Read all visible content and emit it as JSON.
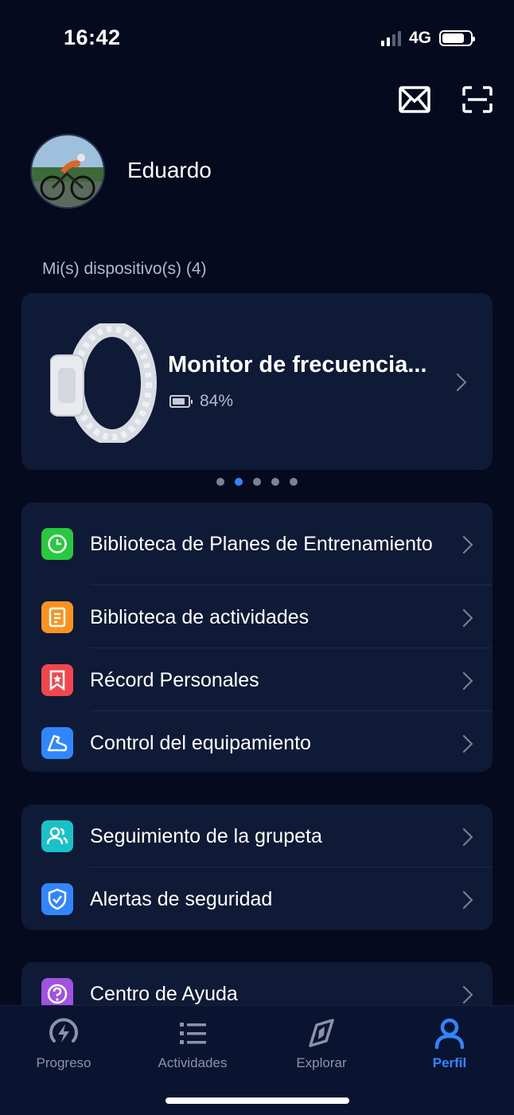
{
  "status_bar": {
    "time": "16:42",
    "network": "4G"
  },
  "profile": {
    "name": "Eduardo"
  },
  "devices": {
    "section_label": "Mi(s) dispositivo(s) (4)",
    "card": {
      "title": "Monitor de frecuencia...",
      "battery": "84%"
    },
    "pager": {
      "count": 5,
      "active_index": 1
    }
  },
  "menu_group_1": [
    {
      "label": "Biblioteca de Planes de Entrenamiento",
      "icon": "clock-icon",
      "color": "#27c93f"
    },
    {
      "label": "Biblioteca de actividades",
      "icon": "document-icon",
      "color": "#f7931e"
    },
    {
      "label": "Récord Personales",
      "icon": "bookmark-star-icon",
      "color": "#f0474f"
    },
    {
      "label": "Control del equipamiento",
      "icon": "shoe-icon",
      "color": "#2f86ff"
    }
  ],
  "menu_group_2": [
    {
      "label": "Seguimiento de la grupeta",
      "icon": "group-icon",
      "color": "#19c2c6"
    },
    {
      "label": "Alertas de seguridad",
      "icon": "shield-check-icon",
      "color": "#2f86ff"
    }
  ],
  "menu_group_3": [
    {
      "label": "Centro de Ayuda",
      "icon": "help-icon",
      "color": "#a352e0"
    }
  ],
  "tab_bar": {
    "tabs": [
      {
        "label": "Progreso",
        "icon": "lightning-icon"
      },
      {
        "label": "Actividades",
        "icon": "list-icon"
      },
      {
        "label": "Explorar",
        "icon": "compass-icon"
      },
      {
        "label": "Perfil",
        "icon": "person-icon"
      }
    ],
    "active": "Perfil",
    "active_color": "#2f86ff"
  }
}
